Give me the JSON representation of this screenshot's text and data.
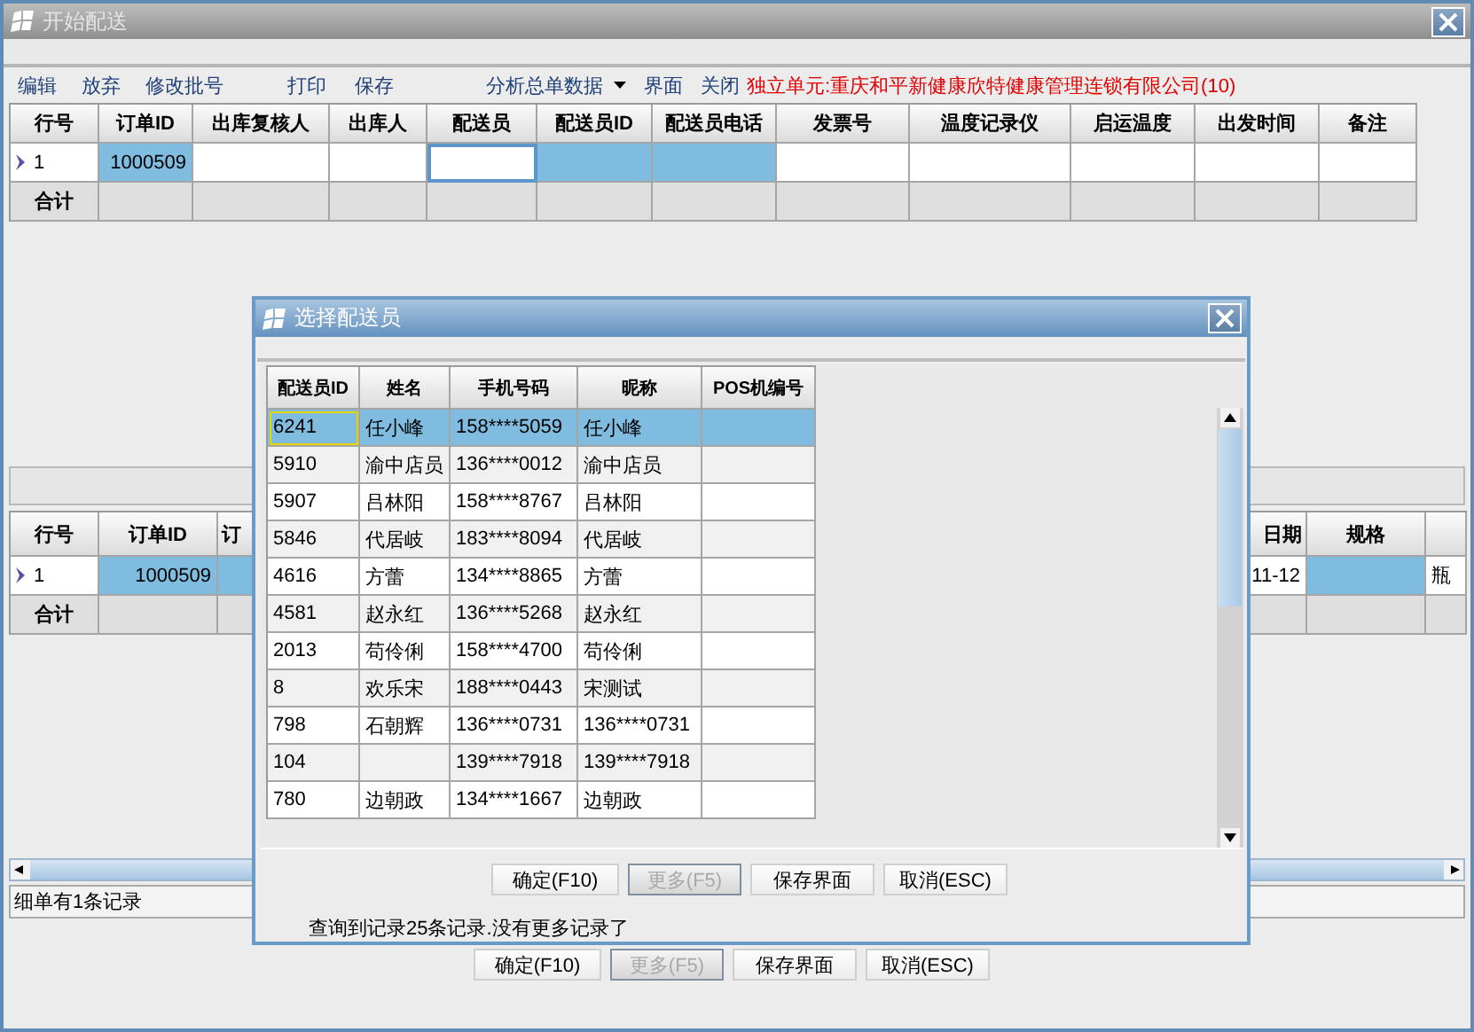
{
  "window": {
    "title": "开始配送"
  },
  "toolbar": {
    "items": [
      {
        "label": "编辑"
      },
      {
        "label": "放弃"
      },
      {
        "label": "修改批号"
      },
      {
        "label": "打印"
      },
      {
        "label": "保存"
      },
      {
        "label": "分析总单数据",
        "dropdown": true
      },
      {
        "label": "界面"
      },
      {
        "label": "关闭"
      }
    ],
    "notice": "独立单元:重庆和平新健康欣特健康管理连锁有限公司(10)"
  },
  "top_grid": {
    "columns": [
      "行号",
      "订单ID",
      "出库复核人",
      "出库人",
      "配送员",
      "配送员ID",
      "配送员电话",
      "发票号",
      "温度记录仪",
      "启运温度",
      "出发时间",
      "备注"
    ],
    "rows": [
      {
        "kind": "data",
        "current": true,
        "cells": [
          {
            "text": "1"
          },
          {
            "text": "1000509",
            "selected": true
          },
          {
            "selected": false
          },
          {
            "selected": false
          },
          {
            "selected": false,
            "focused": true
          },
          {
            "selected": true
          },
          {
            "selected": true
          },
          {
            "selected": false
          },
          {
            "selected": false
          },
          {
            "selected": false
          },
          {
            "selected": false
          },
          {
            "selected": false
          }
        ]
      },
      {
        "kind": "total",
        "current": false,
        "cells": [
          {
            "text": "合计"
          }
        ]
      }
    ]
  },
  "lower_grid": {
    "columns": [
      "行号",
      "订单ID",
      "订",
      "日期",
      "规格"
    ],
    "rows": [
      {
        "kind": "data",
        "current": true,
        "cells": [
          {
            "text": "1"
          },
          {
            "text": "1000509",
            "selected": true
          },
          {
            "selected": true
          },
          {
            "text": "11-12"
          },
          {
            "selected": true
          },
          {
            "text": "瓶"
          }
        ]
      },
      {
        "kind": "total",
        "current": false,
        "cells": [
          {
            "text": "合计"
          }
        ]
      }
    ]
  },
  "status_bar": "细单有1条记录",
  "buttons": [
    {
      "label": "确定(F10)",
      "disabled": false
    },
    {
      "label": "更多(F5)",
      "disabled": true
    },
    {
      "label": "保存界面",
      "disabled": false
    },
    {
      "label": "取消(ESC)",
      "disabled": false
    }
  ],
  "dialog": {
    "title": "选择配送员",
    "columns": [
      "配送员ID",
      "姓名",
      "手机号码",
      "昵称",
      "POS机编号"
    ],
    "rows": [
      {
        "selected": true,
        "cells": [
          "6241",
          "任小峰",
          "158****5059",
          "任小峰"
        ]
      },
      {
        "selected": false,
        "cells": [
          "5910",
          "渝中店员",
          "136****0012",
          "渝中店员"
        ]
      },
      {
        "selected": false,
        "cells": [
          "5907",
          "吕林阳",
          "158****8767",
          "吕林阳"
        ]
      },
      {
        "selected": false,
        "cells": [
          "5846",
          "代居岐",
          "183****8094",
          "代居岐"
        ]
      },
      {
        "selected": false,
        "cells": [
          "4616",
          "方蕾",
          "134****8865",
          "方蕾"
        ]
      },
      {
        "selected": false,
        "cells": [
          "4581",
          "赵永红",
          "136****5268",
          "赵永红"
        ]
      },
      {
        "selected": false,
        "cells": [
          "2013",
          "苟伶俐",
          "158****4700",
          "苟伶俐"
        ]
      },
      {
        "selected": false,
        "cells": [
          "8",
          "欢乐宋",
          "188****0443",
          "宋测试"
        ]
      },
      {
        "selected": false,
        "cells": [
          "798",
          "石朝辉",
          "136****0731",
          "136****0731"
        ]
      },
      {
        "selected": false,
        "cells": [
          "104",
          null,
          "139****7918",
          "139****7918"
        ]
      },
      {
        "selected": false,
        "cells": [
          "780",
          "边朝政",
          "134****1667",
          "边朝政"
        ]
      }
    ],
    "buttons": [
      {
        "label": "确定(F10)",
        "disabled": false
      },
      {
        "label": "更多(F5)",
        "disabled": true
      },
      {
        "label": "保存界面",
        "disabled": false
      },
      {
        "label": "取消(ESC)",
        "disabled": false
      }
    ],
    "message": "查询到记录25条记录.没有更多记录了"
  }
}
